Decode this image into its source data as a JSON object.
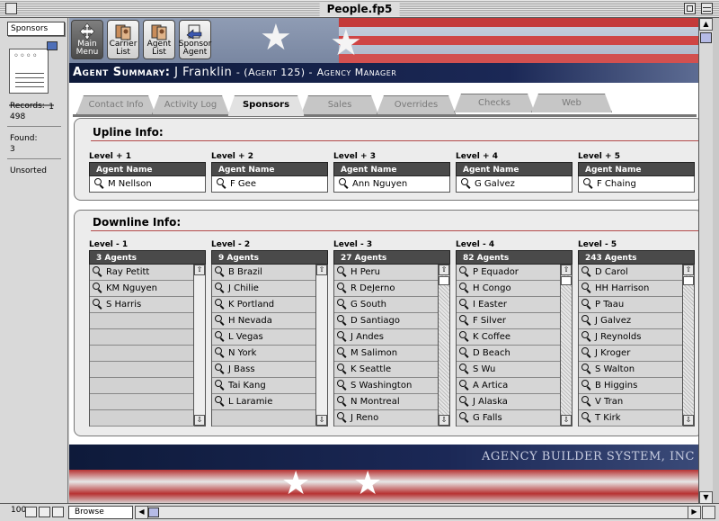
{
  "window": {
    "title": "People.fp5"
  },
  "status_area": {
    "layout_menu": "Sponsors",
    "book_page": "1",
    "records_label": "Records:",
    "records_value": "498",
    "found_label": "Found:",
    "found_value": "3",
    "sort_status": "Unsorted"
  },
  "nav_buttons": [
    {
      "label_line1": "Main",
      "label_line2": "Menu",
      "icon": "grid-arrows-icon"
    },
    {
      "label_line1": "Carrier",
      "label_line2": "List",
      "icon": "people-icon"
    },
    {
      "label_line1": "Agent",
      "label_line2": "List",
      "icon": "people-icon"
    },
    {
      "label_line1": "Sponsor",
      "label_line2": "Agent",
      "icon": "sponsor-icon"
    }
  ],
  "header": {
    "label": "Agent Summary:",
    "agent_name": "J Franklin",
    "agent_id": "- (Agent 125) -",
    "role": "Agency Manager"
  },
  "tabs": [
    "Contact Info",
    "Activity Log",
    "Sponsors",
    "Sales",
    "Overrides",
    "Checks",
    "Web"
  ],
  "active_tab": "Sponsors",
  "upline": {
    "title": "Upline Info:",
    "column_header": "Agent Name",
    "levels": [
      {
        "level": "Level + 1",
        "agent": "M Nellson"
      },
      {
        "level": "Level + 2",
        "agent": "F Gee"
      },
      {
        "level": "Level + 3",
        "agent": "Ann Nguyen"
      },
      {
        "level": "Level + 4",
        "agent": "G Galvez"
      },
      {
        "level": "Level + 5",
        "agent": "F Chaing"
      }
    ]
  },
  "downline": {
    "title": "Downline Info:",
    "levels": [
      {
        "level": "Level - 1",
        "count": "3 Agents",
        "agents": [
          "Ray Petitt",
          "KM Nguyen",
          "S Harris"
        ]
      },
      {
        "level": "Level - 2",
        "count": "9 Agents",
        "agents": [
          "B Brazil",
          "J Chilie",
          "K Portland",
          "H Nevada",
          "L Vegas",
          "N York",
          "J Bass",
          "Tai Kang",
          "L Laramie"
        ]
      },
      {
        "level": "Level - 3",
        "count": "27 Agents",
        "agents": [
          "H Peru",
          "R DeJerno",
          "G South",
          "D Santiago",
          "J Andes",
          "M Salimon",
          "K Seattle",
          "S Washington",
          "N Montreal",
          "J Reno"
        ]
      },
      {
        "level": "Level - 4",
        "count": "82 Agents",
        "agents": [
          "P Equador",
          "H Congo",
          "I Easter",
          "F Silver",
          "K Coffee",
          "D Beach",
          "S Wu",
          "A Artica",
          "J Alaska",
          "G Falls"
        ]
      },
      {
        "level": "Level - 5",
        "count": "243 Agents",
        "agents": [
          "D Carol",
          "HH Harrison",
          "P Taau",
          "J Galvez",
          "J Reynolds",
          "J Kroger",
          "S Walton",
          "B Higgins",
          "V Tran",
          "T Kirk"
        ]
      }
    ]
  },
  "branding": "AGENCY BUILDER SYSTEM, INC",
  "bottom_bar": {
    "zoom": "100",
    "mode": "Browse"
  }
}
